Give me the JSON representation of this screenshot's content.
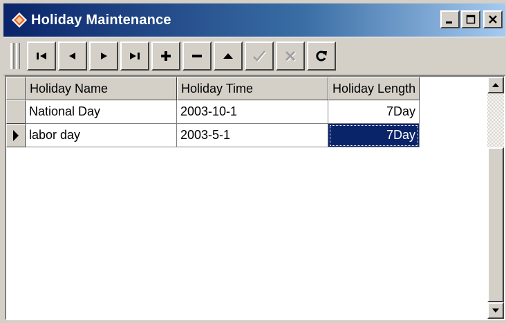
{
  "window": {
    "title": "Holiday Maintenance",
    "icon": "app-diamond-icon",
    "title_bar_colors": {
      "start": "#0a246a",
      "end": "#a6caf0"
    },
    "controls": {
      "minimize": "_",
      "maximize": "□",
      "close": "×"
    }
  },
  "navigator": {
    "buttons": [
      {
        "name": "first",
        "icon": "first-record-icon",
        "enabled": true
      },
      {
        "name": "prior",
        "icon": "prior-record-icon",
        "enabled": true
      },
      {
        "name": "next",
        "icon": "next-record-icon",
        "enabled": true
      },
      {
        "name": "last",
        "icon": "last-record-icon",
        "enabled": true
      },
      {
        "name": "insert",
        "icon": "plus-icon",
        "enabled": true
      },
      {
        "name": "delete",
        "icon": "minus-icon",
        "enabled": true
      },
      {
        "name": "edit",
        "icon": "triangle-up-icon",
        "enabled": true
      },
      {
        "name": "post",
        "icon": "checkmark-icon",
        "enabled": false
      },
      {
        "name": "cancel",
        "icon": "cross-icon",
        "enabled": false
      },
      {
        "name": "refresh",
        "icon": "refresh-icon",
        "enabled": true
      }
    ]
  },
  "grid": {
    "columns": [
      "Holiday Name",
      "Holiday Time",
      "Holiday Length"
    ],
    "rows": [
      {
        "name": "National Day",
        "time": "2003-10-1",
        "length": "7Day",
        "current": false
      },
      {
        "name": "labor day",
        "time": "2003-5-1",
        "length": "7Day",
        "current": true
      }
    ],
    "selection_color": "#0a246a"
  }
}
